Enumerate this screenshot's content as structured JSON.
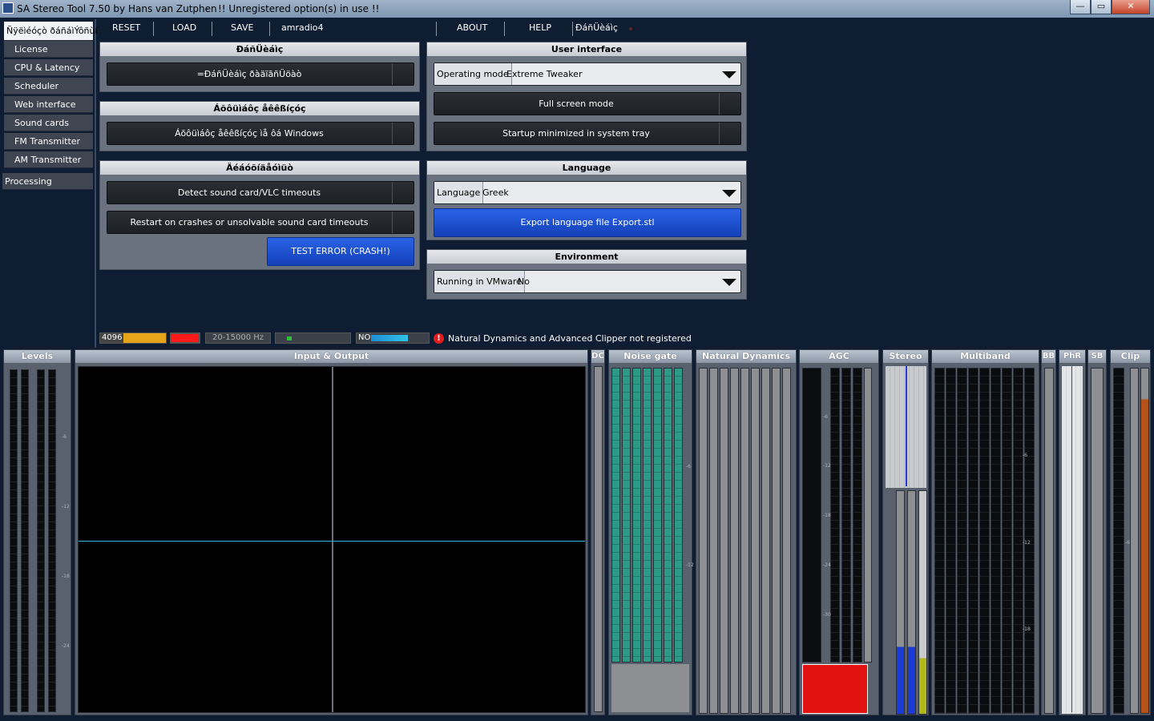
{
  "window": {
    "title": "SA Stereo Tool 7.50 by Hans van Zutphen",
    "title_sep": "-",
    "warning": "!! Unregistered option(s) in use !!",
    "buttons": {
      "minimize": "—",
      "maximize": "▭",
      "close": "✕"
    }
  },
  "sidebar": {
    "items": [
      {
        "label": "Ñÿëìéóçò ðáñáìÝôñùí",
        "active": true
      },
      {
        "label": "License"
      },
      {
        "label": "CPU & Latency"
      },
      {
        "label": "Scheduler"
      },
      {
        "label": "Web interface"
      },
      {
        "label": "Sound cards"
      },
      {
        "label": "FM Transmitter"
      },
      {
        "label": "AM Transmitter"
      },
      {
        "label": "Processing",
        "category": true
      }
    ]
  },
  "menu": {
    "reset": "RESET",
    "load": "LOAD",
    "save": "SAVE",
    "preset": "amradio4",
    "about": "ABOUT",
    "help": "HELP",
    "extra": "ÐáñÜèáìç"
  },
  "panels": {
    "p1": {
      "title": "ÐáñÜèáìç",
      "button": "=ÐáñÜèáìç ðàäïãñÜöàò"
    },
    "p2": {
      "title": "Áõôüìáôç åêêßíçóç",
      "button": "Áõôüìáôç åêêßíçóç ìå ôá Windows"
    },
    "p3": {
      "title": "Äéáóõíäåóìüò",
      "btn1": "Detect sound card/VLC timeouts",
      "btn2": "Restart on crashes or unsolvable sound card timeouts",
      "btn3": "TEST ERROR (CRASH!)"
    },
    "ui": {
      "title": "User interface",
      "mode_label": "Operating mode",
      "mode_value": "Extreme Tweaker",
      "fullscreen": "Full screen mode",
      "startup": "Startup minimized in system tray"
    },
    "language": {
      "title": "Language",
      "label": "Language",
      "value": "Greek",
      "export": "Export language file Export.stl"
    },
    "environment": {
      "title": "Environment",
      "label": "Running in VMware",
      "value": "No"
    }
  },
  "status": {
    "buffer": "4096",
    "freq": "20-15000 Hz",
    "no": "NO",
    "message": "Natural Dynamics and Advanced Clipper not registered"
  },
  "meters": {
    "levels": "Levels",
    "io": "Input & Output",
    "dc": "DC",
    "noise": "Noise gate",
    "nd": "Natural Dynamics",
    "agc": "AGC",
    "stereo": "Stereo",
    "multiband": "Multiband",
    "bb": "BB",
    "phr": "PhR",
    "sb": "SB",
    "clip": "Clip"
  },
  "ticks": {
    "m6": "-6",
    "m12": "-12",
    "m18": "-18",
    "m24": "-24",
    "m30": "-30"
  },
  "colors": {
    "blue_button": "#1f52d6",
    "status_orange": "#e6a41a",
    "status_red": "#ff1a1a",
    "agc_red": "#e31212",
    "io_line": "#2fb3d6"
  }
}
